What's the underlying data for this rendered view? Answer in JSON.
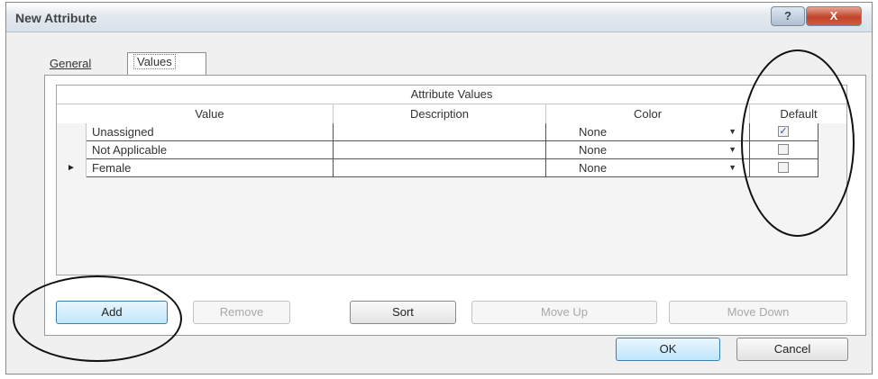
{
  "window": {
    "title": "New Attribute",
    "help_label": "?",
    "close_label": "X"
  },
  "tabs": [
    {
      "label": "General"
    },
    {
      "label": "Values"
    }
  ],
  "grid": {
    "caption": "Attribute Values",
    "columns": [
      "Value",
      "Description",
      "Color",
      "Default"
    ],
    "rows": [
      {
        "indicator": "",
        "value": "Unassigned",
        "description": "",
        "color": "None",
        "default": true
      },
      {
        "indicator": "",
        "value": "Not Applicable",
        "description": "",
        "color": "None",
        "default": false
      },
      {
        "indicator": "►",
        "value": "Female",
        "description": "",
        "color": "None",
        "default": false
      }
    ],
    "dropdown_glyph": "▼",
    "check_glyph": "✓"
  },
  "buttons": {
    "add": "Add",
    "remove": "Remove",
    "sort": "Sort",
    "move_up": "Move Up",
    "move_down": "Move Down",
    "ok": "OK",
    "cancel": "Cancel"
  },
  "icons": {
    "dropdown": "chevron-down-icon",
    "row_pointer": "row-pointer-icon",
    "checkbox": "checkbox-icon"
  }
}
